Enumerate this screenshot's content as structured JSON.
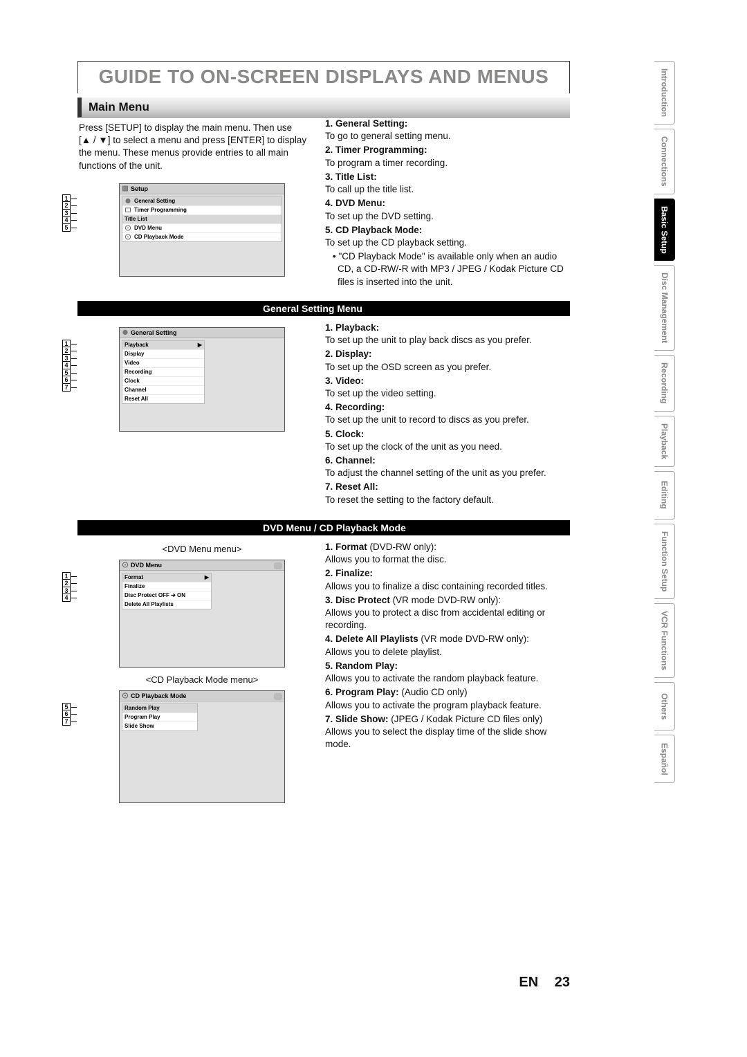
{
  "page": {
    "title": "GUIDE TO ON-SCREEN DISPLAYS AND MENUS",
    "section": "Main Menu",
    "intro_line1": "Press [SETUP] to display the main menu. Then use",
    "intro_line2": "[▲ / ▼] to select a menu and press [ENTER] to display the menu. These menus provide entries to all main functions of the unit.",
    "footer_lang": "EN",
    "footer_page": "23"
  },
  "main_menu_osd": {
    "title": "Setup",
    "items": [
      "General Setting",
      "Timer Programming",
      "Title List",
      "DVD Menu",
      "CD Playback Mode"
    ],
    "numbers": [
      "1",
      "2",
      "3",
      "4",
      "5"
    ]
  },
  "main_menu_desc": [
    {
      "n": "1.",
      "t": "General Setting:",
      "d": "To go to general setting menu."
    },
    {
      "n": "2.",
      "t": "Timer Programming:",
      "d": "To program a timer recording."
    },
    {
      "n": "3.",
      "t": "Title List:",
      "d": "To call up the title list."
    },
    {
      "n": "4.",
      "t": "DVD Menu:",
      "d": "To set up the DVD setting."
    },
    {
      "n": "5.",
      "t": "CD Playback Mode:",
      "d": "To set up the CD playback setting."
    }
  ],
  "cd_note": "• \"CD Playback Mode\" is available only when an audio CD, a CD-RW/-R with MP3 / JPEG / Kodak Picture CD files is inserted into the unit.",
  "bar1": "General Setting Menu",
  "gs_osd": {
    "title": "General Setting",
    "items": [
      "Playback",
      "Display",
      "Video",
      "Recording",
      "Clock",
      "Channel",
      "Reset All"
    ],
    "numbers": [
      "1",
      "2",
      "3",
      "4",
      "5",
      "6",
      "7"
    ]
  },
  "gs_desc": [
    {
      "n": "1.",
      "t": "Playback:",
      "d": "To set up the unit to play back discs as you prefer."
    },
    {
      "n": "2.",
      "t": "Display:",
      "d": "To set up the OSD screen as you prefer."
    },
    {
      "n": "3.",
      "t": "Video:",
      "d": "To set up the video setting."
    },
    {
      "n": "4.",
      "t": "Recording:",
      "d": "To set up the unit to record to discs as you prefer."
    },
    {
      "n": "5.",
      "t": "Clock:",
      "d": "To set up the clock of the unit as you need."
    },
    {
      "n": "6.",
      "t": "Channel:",
      "d": "To adjust the channel setting of the unit as you prefer."
    },
    {
      "n": "7.",
      "t": "Reset All:",
      "d": "To reset the setting to the factory default."
    }
  ],
  "bar2": "DVD Menu / CD Playback Mode",
  "dvd_caption": "<DVD Menu menu>",
  "dvd_osd": {
    "title": "DVD Menu",
    "items": [
      "Format",
      "Finalize",
      "Disc Protect OFF ➔ ON",
      "Delete All Playlists"
    ],
    "numbers": [
      "1",
      "2",
      "3",
      "4"
    ]
  },
  "cd_caption": "<CD Playback Mode menu>",
  "cd_osd": {
    "title": "CD Playback Mode",
    "items": [
      "Random Play",
      "Program Play",
      "Slide Show"
    ],
    "numbers": [
      "5",
      "6",
      "7"
    ]
  },
  "dvd_desc": [
    {
      "n": "1.",
      "t": "Format",
      "suffix": " (DVD-RW only):",
      "d": "Allows you to format the disc."
    },
    {
      "n": "2.",
      "t": "Finalize:",
      "suffix": "",
      "d": "Allows you to finalize a disc containing recorded titles."
    },
    {
      "n": "3.",
      "t": "Disc Protect",
      "suffix": " (VR mode DVD-RW only):",
      "d": "Allows you to protect a disc from accidental editing or recording."
    },
    {
      "n": "4.",
      "t": "Delete All Playlists",
      "suffix": " (VR mode DVD-RW only):",
      "d": "Allows you to delete playlist."
    },
    {
      "n": "5.",
      "t": "Random Play:",
      "suffix": "",
      "d": "Allows you to activate the random playback feature."
    },
    {
      "n": "6.",
      "t": "Program Play:",
      "suffix": " (Audio CD only)",
      "d": "Allows you to activate the program playback feature."
    },
    {
      "n": "7.",
      "t": "Slide Show:",
      "suffix": " (JPEG / Kodak Picture CD files only)",
      "d": "Allows you to select the display time of the slide show mode."
    }
  ],
  "tabs": [
    "Introduction",
    "Connections",
    "Basic Setup",
    "Disc\nManagement",
    "Recording",
    "Playback",
    "Editing",
    "Function\nSetup",
    "VCR Functions",
    "Others",
    "Español"
  ],
  "active_tab_index": 2
}
